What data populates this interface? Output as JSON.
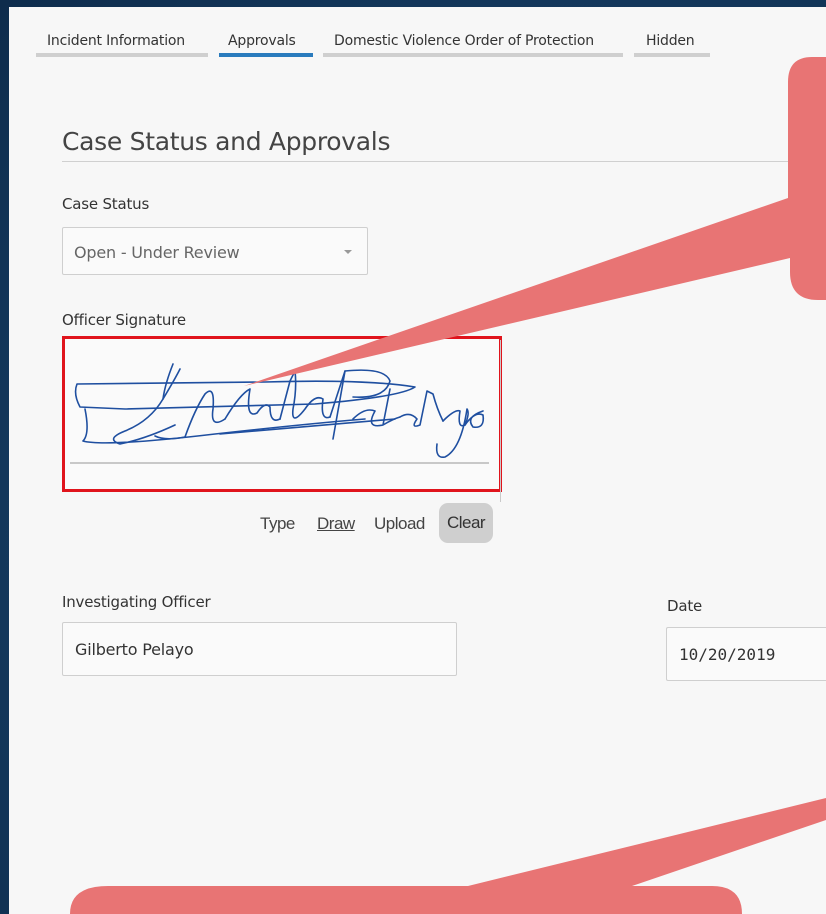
{
  "tabs": [
    {
      "label": "Incident Information",
      "active": false
    },
    {
      "label": "Approvals",
      "active": true
    },
    {
      "label": "Domestic Violence Order of Protection",
      "active": false
    },
    {
      "label": "Hidden",
      "active": false
    }
  ],
  "section": {
    "title": "Case Status and Approvals"
  },
  "case_status": {
    "label": "Case Status",
    "value": "Open - Under Review"
  },
  "signature": {
    "label": "Officer Signature",
    "options": {
      "type": "Type",
      "draw": "Draw",
      "upload": "Upload",
      "clear": "Clear"
    }
  },
  "investigating_officer": {
    "label": "Investigating Officer",
    "value": "Gilberto Pelayo"
  },
  "date": {
    "label": "Date",
    "value": "10/20/2019"
  },
  "colors": {
    "accent": "#2a7bbd",
    "callout": "#e87474",
    "highlight_border": "#e0141c",
    "signature_ink": "#1f4fa0"
  }
}
